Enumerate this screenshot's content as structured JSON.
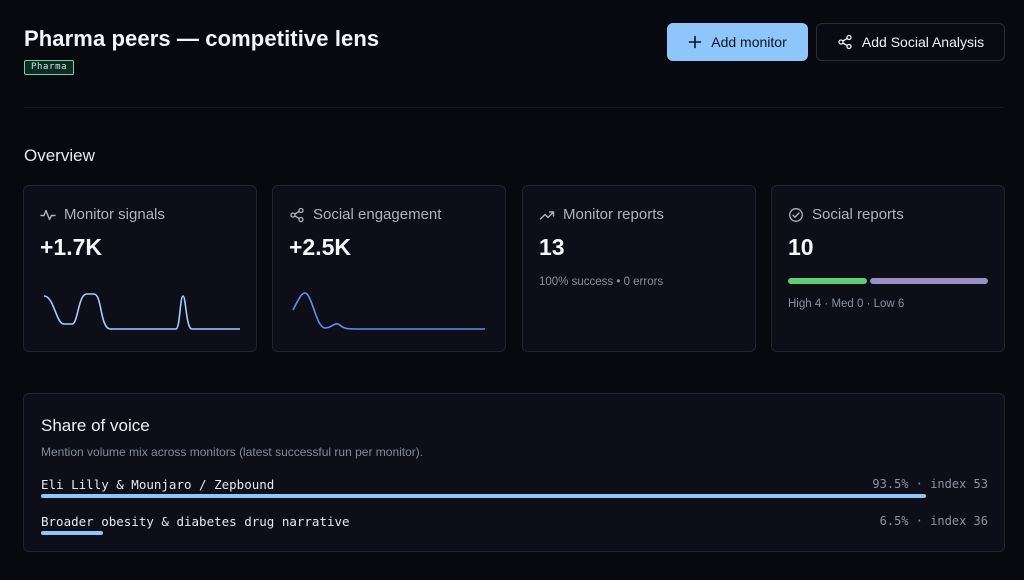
{
  "header": {
    "title": "Pharma peers — competitive lens",
    "tag": "Pharma",
    "add_monitor_label": "Add monitor",
    "add_social_label": "Add Social Analysis"
  },
  "overview": {
    "title": "Overview",
    "cards": [
      {
        "label": "Monitor signals",
        "value": "+1.7K",
        "icon": "activity-icon"
      },
      {
        "label": "Social engagement",
        "value": "+2.5K",
        "icon": "share-icon"
      },
      {
        "label": "Monitor reports",
        "value": "13",
        "sub": "100% success • 0 errors",
        "icon": "trending-up-icon"
      },
      {
        "label": "Social reports",
        "value": "10",
        "sub": "High 4 · Med 0 · Low 6",
        "icon": "check-circle-icon",
        "severity": {
          "high": 4,
          "med": 0,
          "low": 6
        }
      }
    ]
  },
  "share_of_voice": {
    "title": "Share of voice",
    "subtitle": "Mention volume mix across monitors (latest successful run per monitor).",
    "rows": [
      {
        "label": "Eli Lilly & Mounjaro / Zepbound",
        "meta": "93.5% · index 53",
        "share": 93.5
      },
      {
        "label": "Broader obesity & diabetes drug narrative",
        "meta": "6.5% · index 36",
        "share": 6.5
      }
    ]
  },
  "colors": {
    "accent": "#8ec5fa",
    "spark_light": "#9fd0ff",
    "spark_blue": "#5b8ff0",
    "severity_high": "#5fcf73",
    "severity_low": "#9a8ec7"
  }
}
